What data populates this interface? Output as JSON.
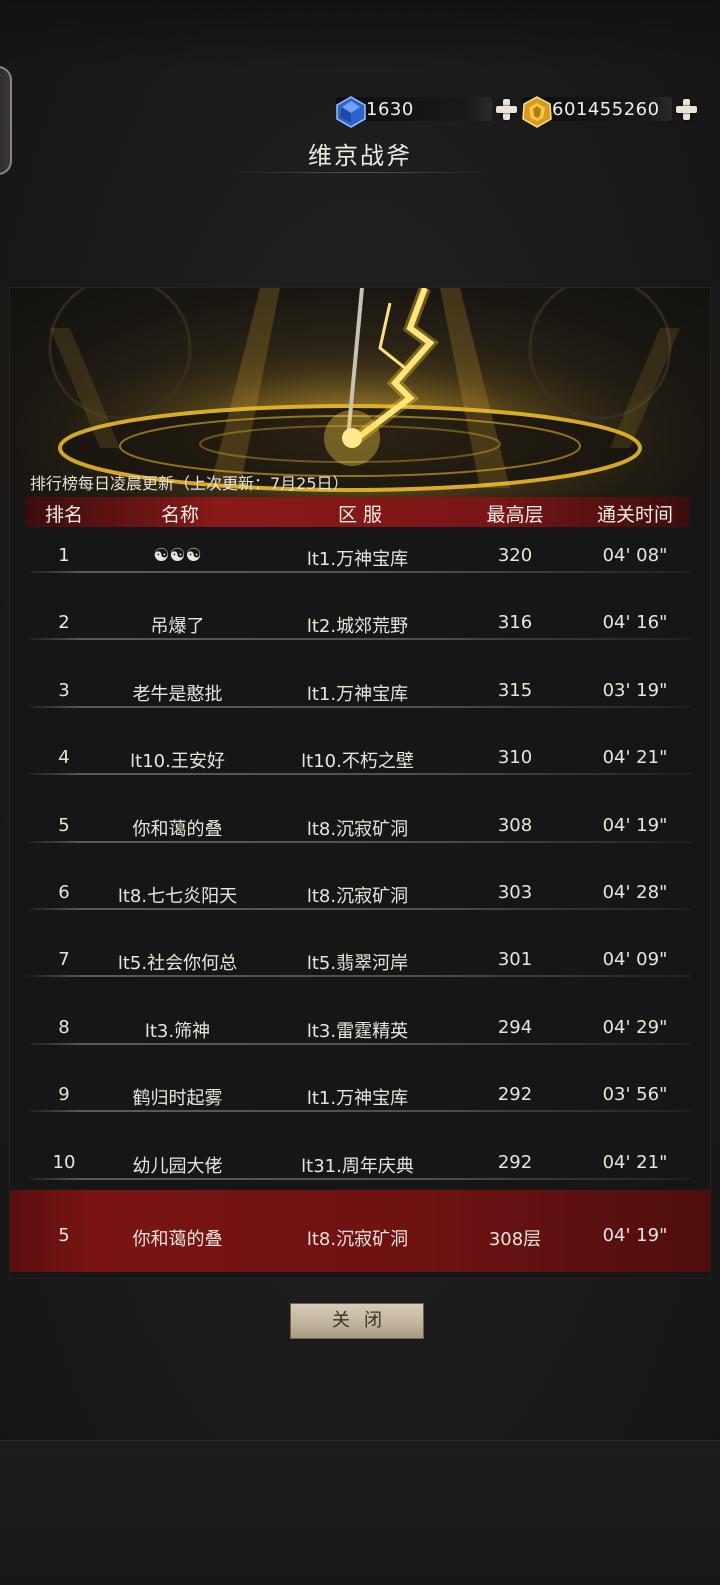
{
  "currency": [
    {
      "name": "diamond-currency",
      "value": "1630",
      "gem_color": "#3a78e0"
    },
    {
      "name": "gold-currency",
      "value": "601455260",
      "gem_color": "#e6b33a"
    }
  ],
  "page_title": "维京战斧",
  "notice": "排行榜每日凌晨更新（上次更新：7月25日）",
  "headers": [
    "排名",
    "名称",
    "区 服",
    "最高层",
    "通关时间"
  ],
  "rows": [
    {
      "rank": "1",
      "name": "☯☯☯",
      "server": "lt1.万神宝库",
      "floor": "320",
      "time": "04' 08\""
    },
    {
      "rank": "2",
      "name": "吊爆了",
      "server": "lt2.城郊荒野",
      "floor": "316",
      "time": "04' 16\""
    },
    {
      "rank": "3",
      "name": "老牛是憨批",
      "server": "lt1.万神宝库",
      "floor": "315",
      "time": "03' 19\""
    },
    {
      "rank": "4",
      "name": "lt10.王安好",
      "server": "lt10.不朽之壁",
      "floor": "310",
      "time": "04' 21\""
    },
    {
      "rank": "5",
      "name": "你和蔼的叠",
      "server": "lt8.沉寂矿洞",
      "floor": "308",
      "time": "04' 19\""
    },
    {
      "rank": "6",
      "name": "lt8.七七炎阳天",
      "server": "lt8.沉寂矿洞",
      "floor": "303",
      "time": "04' 28\""
    },
    {
      "rank": "7",
      "name": "lt5.社会你何总",
      "server": "lt5.翡翠河岸",
      "floor": "301",
      "time": "04' 09\""
    },
    {
      "rank": "8",
      "name": "lt3.筛神",
      "server": "lt3.雷霆精英",
      "floor": "294",
      "time": "04' 29\""
    },
    {
      "rank": "9",
      "name": "鹤归时起雾",
      "server": "lt1.万神宝库",
      "floor": "292",
      "time": "03' 56\""
    },
    {
      "rank": "10",
      "name": "幼儿园大佬",
      "server": "lt31.周年庆典",
      "floor": "292",
      "time": "04' 21\""
    }
  ],
  "my_rank": {
    "rank": "5",
    "name": "你和蔼的叠",
    "server": "lt8.沉寂矿洞",
    "floor": "308层",
    "time": "04' 19\""
  },
  "close_label": "关闭",
  "colors": {
    "header_red": "#8a1a1a",
    "my_row_red": "#7a1414",
    "gold": "#e6b33a"
  }
}
